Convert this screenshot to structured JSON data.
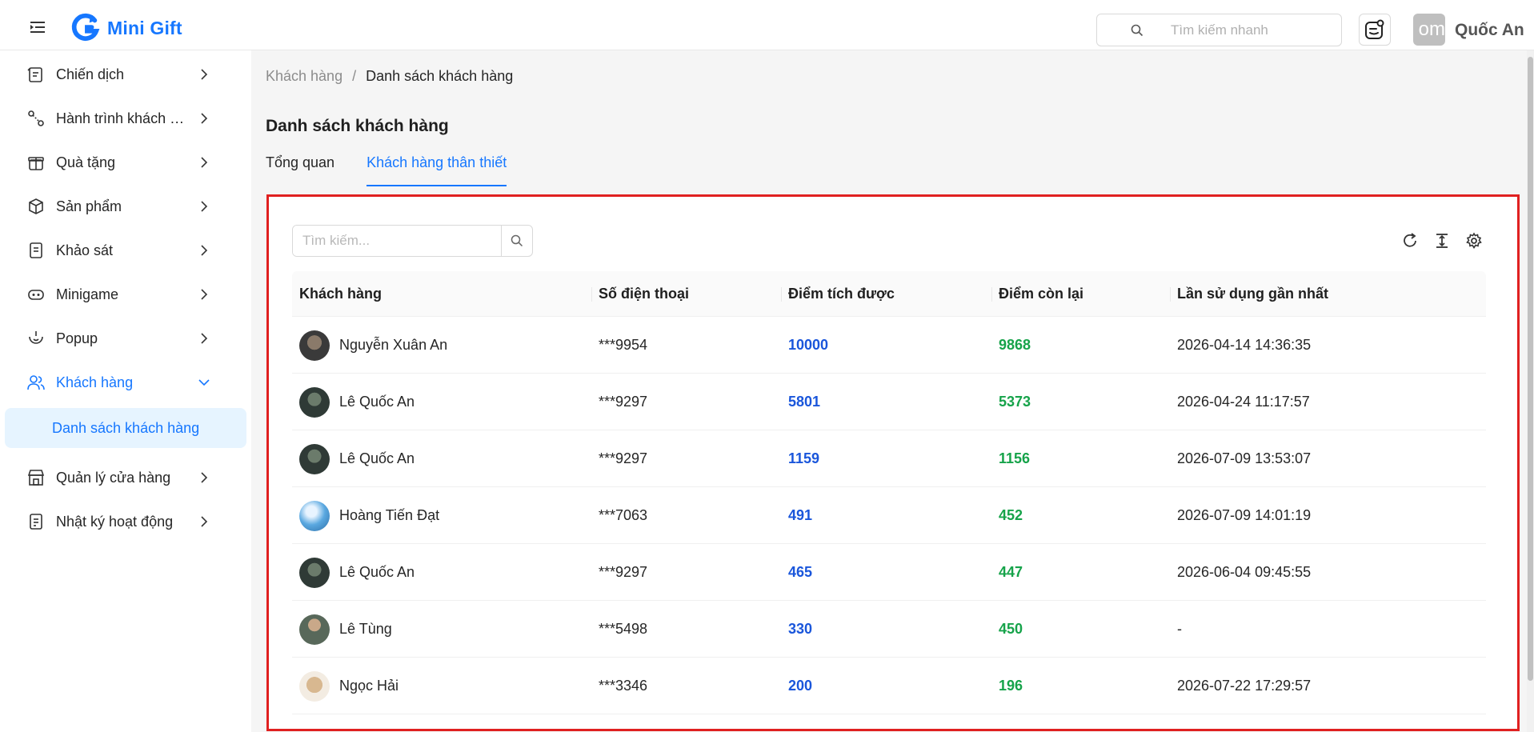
{
  "header": {
    "app_name": "Mini Gift",
    "quick_search_placeholder": "Tìm kiếm nhanh",
    "avatar_initials": "om",
    "user_name": "Quốc An"
  },
  "sidebar": {
    "items": [
      {
        "label": "Chiến dịch",
        "icon": "campaign-icon"
      },
      {
        "label": "Hành trình khách hàng",
        "icon": "journey-icon"
      },
      {
        "label": "Quà tặng",
        "icon": "gift-icon"
      },
      {
        "label": "Sản phẩm",
        "icon": "box-icon"
      },
      {
        "label": "Khảo sát",
        "icon": "survey-icon"
      },
      {
        "label": "Minigame",
        "icon": "gamepad-icon"
      },
      {
        "label": "Popup",
        "icon": "popup-icon"
      },
      {
        "label": "Khách hàng",
        "icon": "users-icon"
      },
      {
        "label": "Quản lý cửa hàng",
        "icon": "store-icon"
      },
      {
        "label": "Nhật ký hoạt động",
        "icon": "log-icon"
      }
    ],
    "active_sub": "Danh sách khách hàng"
  },
  "breadcrumb": {
    "parent": "Khách hàng",
    "separator": "/",
    "current": "Danh sách khách hàng"
  },
  "page": {
    "title": "Danh sách khách hàng"
  },
  "tabs": [
    {
      "label": "Tổng quan"
    },
    {
      "label": "Khách hàng thân thiết"
    }
  ],
  "table": {
    "search_placeholder": "Tìm kiếm...",
    "columns": [
      "Khách hàng",
      "Số điện thoại",
      "Điểm tích được",
      "Điểm còn lại",
      "Lần sử dụng gần nhất"
    ],
    "rows": [
      {
        "name": "Nguyễn Xuân An",
        "phone": "***9954",
        "earned": "10000",
        "remaining": "9868",
        "last_used": "2026-04-14 14:36:35"
      },
      {
        "name": "Lê Quốc An",
        "phone": "***9297",
        "earned": "5801",
        "remaining": "5373",
        "last_used": "2026-04-24 11:17:57"
      },
      {
        "name": "Lê Quốc An",
        "phone": "***9297",
        "earned": "1159",
        "remaining": "1156",
        "last_used": "2026-07-09 13:53:07"
      },
      {
        "name": "Hoàng Tiến Đạt",
        "phone": "***7063",
        "earned": "491",
        "remaining": "452",
        "last_used": "2026-07-09 14:01:19"
      },
      {
        "name": "Lê Quốc An",
        "phone": "***9297",
        "earned": "465",
        "remaining": "447",
        "last_used": "2026-06-04 09:45:55"
      },
      {
        "name": "Lê Tùng",
        "phone": "***5498",
        "earned": "330",
        "remaining": "450",
        "last_used": "-"
      },
      {
        "name": "Ngọc Hải",
        "phone": "***3346",
        "earned": "200",
        "remaining": "196",
        "last_used": "2026-07-22 17:29:57"
      }
    ]
  },
  "colors": {
    "accent": "#1677ff",
    "earned": "#1a56db",
    "remaining": "#16a34a",
    "highlight_border": "#e02020"
  }
}
